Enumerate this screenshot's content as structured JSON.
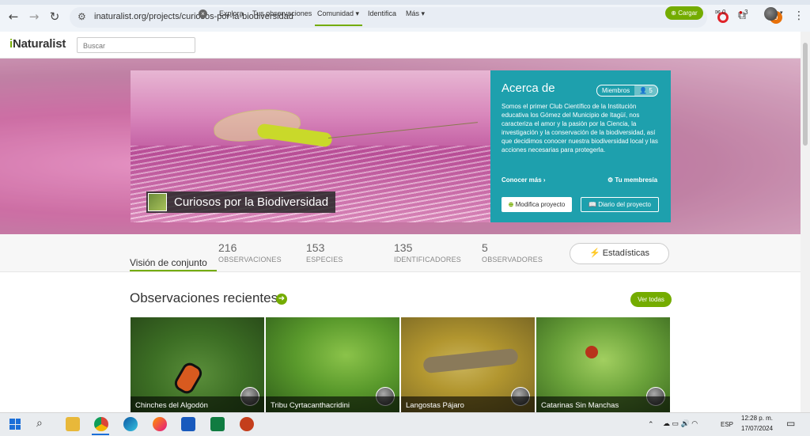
{
  "browser": {
    "url": "inaturalist.org/projects/curiosos-por-la-biodiversidad",
    "profile_badge": "9"
  },
  "header": {
    "logo": "iNaturalist",
    "search_placeholder": "Buscar",
    "nav": [
      "Explora",
      "Tus observaciones",
      "Comunidad ▾",
      "Identifica",
      "Más ▾"
    ],
    "upload_label": "⊕ Cargar",
    "messages_count": "0",
    "notifications_count": "3"
  },
  "project": {
    "title": "Curiosos por la Biodiversidad",
    "about_title": "Acerca de",
    "members_label": "Miembros",
    "members_count": "5",
    "description": "Somos el primer Club Científico de la Institución educativa los Gómez del Municipio de Itagüí, nos caracteriza el amor y la pasión por la Ciencia, la investigación y la conservación de la biodiversidad, así que decidimos conocer nuestra biodiversidad local y las acciones necesarias para protegerla.",
    "learn_more": "Conocer más ›",
    "my_membership": "⚙ Tu membresía",
    "edit_label": "Modifica proyecto",
    "journal_label": "📖 Diario del proyecto"
  },
  "stats": {
    "overview_tab": "Visión de conjunto",
    "items": [
      {
        "value": "216",
        "label": "OBSERVACIONES"
      },
      {
        "value": "153",
        "label": "ESPECIES"
      },
      {
        "value": "135",
        "label": "IDENTIFICADORES"
      },
      {
        "value": "5",
        "label": "OBSERVADORES"
      }
    ],
    "stats_button": "Estadísticas"
  },
  "recent": {
    "title": "Observaciones recientes",
    "view_all": "Ver todas",
    "cards": [
      {
        "caption": "Chinches del Algodón"
      },
      {
        "caption": "Tribu Cyrtacanthacridini"
      },
      {
        "caption": "Langostas Pájaro"
      },
      {
        "caption": "Catarinas Sin Manchas"
      }
    ]
  },
  "taskbar": {
    "lang": "ESP",
    "time": "12:28 p. m.",
    "date": "17/07/2024"
  }
}
